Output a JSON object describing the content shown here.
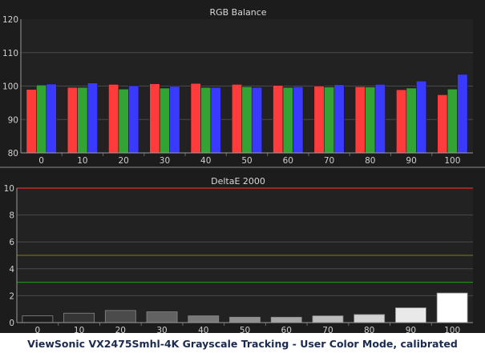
{
  "caption": "ViewSonic VX2475Smhl-4K Grayscale Tracking - User Color Mode, calibrated",
  "chart_data": [
    {
      "type": "bar",
      "title": "RGB Balance",
      "categories": [
        "0",
        "10",
        "20",
        "30",
        "40",
        "50",
        "60",
        "70",
        "80",
        "90",
        "100"
      ],
      "ylim": [
        80,
        120
      ],
      "yticks": [
        "80",
        "90",
        "100",
        "110",
        "120"
      ],
      "grid": true,
      "series": [
        {
          "color": "#ff3b3b",
          "values": [
            99.0,
            99.6,
            100.5,
            100.7,
            100.8,
            100.5,
            100.2,
            100.0,
            99.8,
            98.9,
            97.4
          ]
        },
        {
          "color": "#33a333",
          "values": [
            100.3,
            99.6,
            99.1,
            99.4,
            99.6,
            99.8,
            99.6,
            99.7,
            99.7,
            99.4,
            99.1
          ]
        },
        {
          "color": "#3a3aff",
          "values": [
            100.6,
            100.9,
            100.1,
            99.9,
            99.6,
            99.6,
            99.8,
            100.4,
            100.5,
            101.5,
            103.5
          ]
        }
      ]
    },
    {
      "type": "bar",
      "title": "DeltaE 2000",
      "categories": [
        "0",
        "10",
        "20",
        "30",
        "40",
        "50",
        "60",
        "70",
        "80",
        "90",
        "100"
      ],
      "ylim": [
        0,
        10
      ],
      "yticks": [
        "0",
        "2",
        "4",
        "6",
        "8",
        "10"
      ],
      "grid": true,
      "reference_lines": [
        {
          "value": 10,
          "color": "#e03030"
        },
        {
          "value": 5,
          "color": "#6b6b10"
        },
        {
          "value": 3,
          "color": "#1e8a1e"
        }
      ],
      "values": [
        0.5,
        0.7,
        0.9,
        0.8,
        0.5,
        0.4,
        0.4,
        0.5,
        0.6,
        1.1,
        2.2
      ]
    }
  ]
}
